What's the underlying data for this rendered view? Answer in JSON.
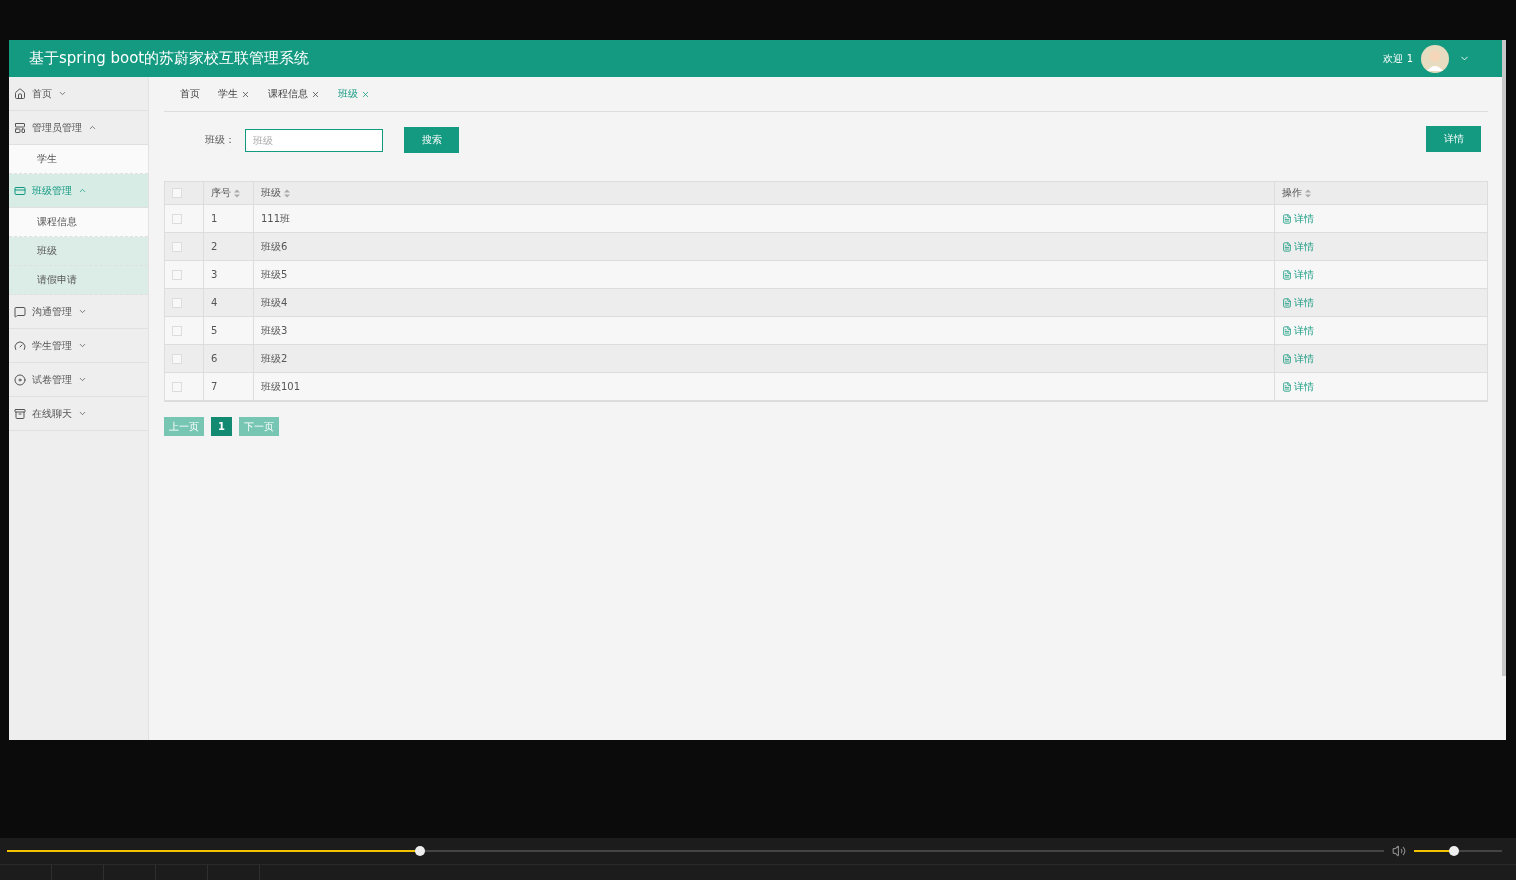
{
  "header": {
    "title": "基于spring boot的苏蔚家校互联管理系统",
    "welcome": "欢迎 1"
  },
  "sidebar": {
    "items": [
      {
        "label": "首页",
        "expanded": false,
        "selected": false
      },
      {
        "label": "管理员管理",
        "expanded": true,
        "selected": false,
        "children": [
          {
            "label": "学生",
            "selected": false
          }
        ]
      },
      {
        "label": "班级管理",
        "expanded": true,
        "selected": true,
        "children": [
          {
            "label": "课程信息",
            "selected": false
          },
          {
            "label": "班级",
            "selected": true
          },
          {
            "label": "请假申请",
            "selected": true
          }
        ]
      },
      {
        "label": "沟通管理",
        "expanded": false,
        "selected": false
      },
      {
        "label": "学生管理",
        "expanded": false,
        "selected": false
      },
      {
        "label": "试卷管理",
        "expanded": false,
        "selected": false
      },
      {
        "label": "在线聊天",
        "expanded": false,
        "selected": false
      }
    ]
  },
  "tabs": [
    {
      "label": "首页",
      "closable": false,
      "selected": false
    },
    {
      "label": "学生",
      "closable": true,
      "selected": false
    },
    {
      "label": "课程信息",
      "closable": true,
      "selected": false
    },
    {
      "label": "班级",
      "closable": true,
      "selected": true
    }
  ],
  "search": {
    "label": "班级：",
    "placeholder": "班级",
    "button": "搜索"
  },
  "detail_button": "详情",
  "table": {
    "select_all": {
      "checked": false
    },
    "columns": [
      "序号",
      "班级",
      "操作"
    ],
    "rows": [
      {
        "checked": false,
        "index": "1",
        "name": "111班",
        "action": "详情"
      },
      {
        "checked": false,
        "index": "2",
        "name": "班级6",
        "action": "详情"
      },
      {
        "checked": false,
        "index": "3",
        "name": "班级5",
        "action": "详情"
      },
      {
        "checked": false,
        "index": "4",
        "name": "班级4",
        "action": "详情"
      },
      {
        "checked": false,
        "index": "5",
        "name": "班级3",
        "action": "详情"
      },
      {
        "checked": false,
        "index": "6",
        "name": "班级2",
        "action": "详情"
      },
      {
        "checked": false,
        "index": "7",
        "name": "班级101",
        "action": "详情"
      }
    ]
  },
  "pagination": [
    {
      "label": "上一页",
      "selected": false
    },
    {
      "label": "1",
      "selected": true
    },
    {
      "label": "下一页",
      "selected": false
    }
  ],
  "player": {
    "progress": {
      "level": 0.3
    },
    "volume": {
      "level": 0.45
    }
  }
}
